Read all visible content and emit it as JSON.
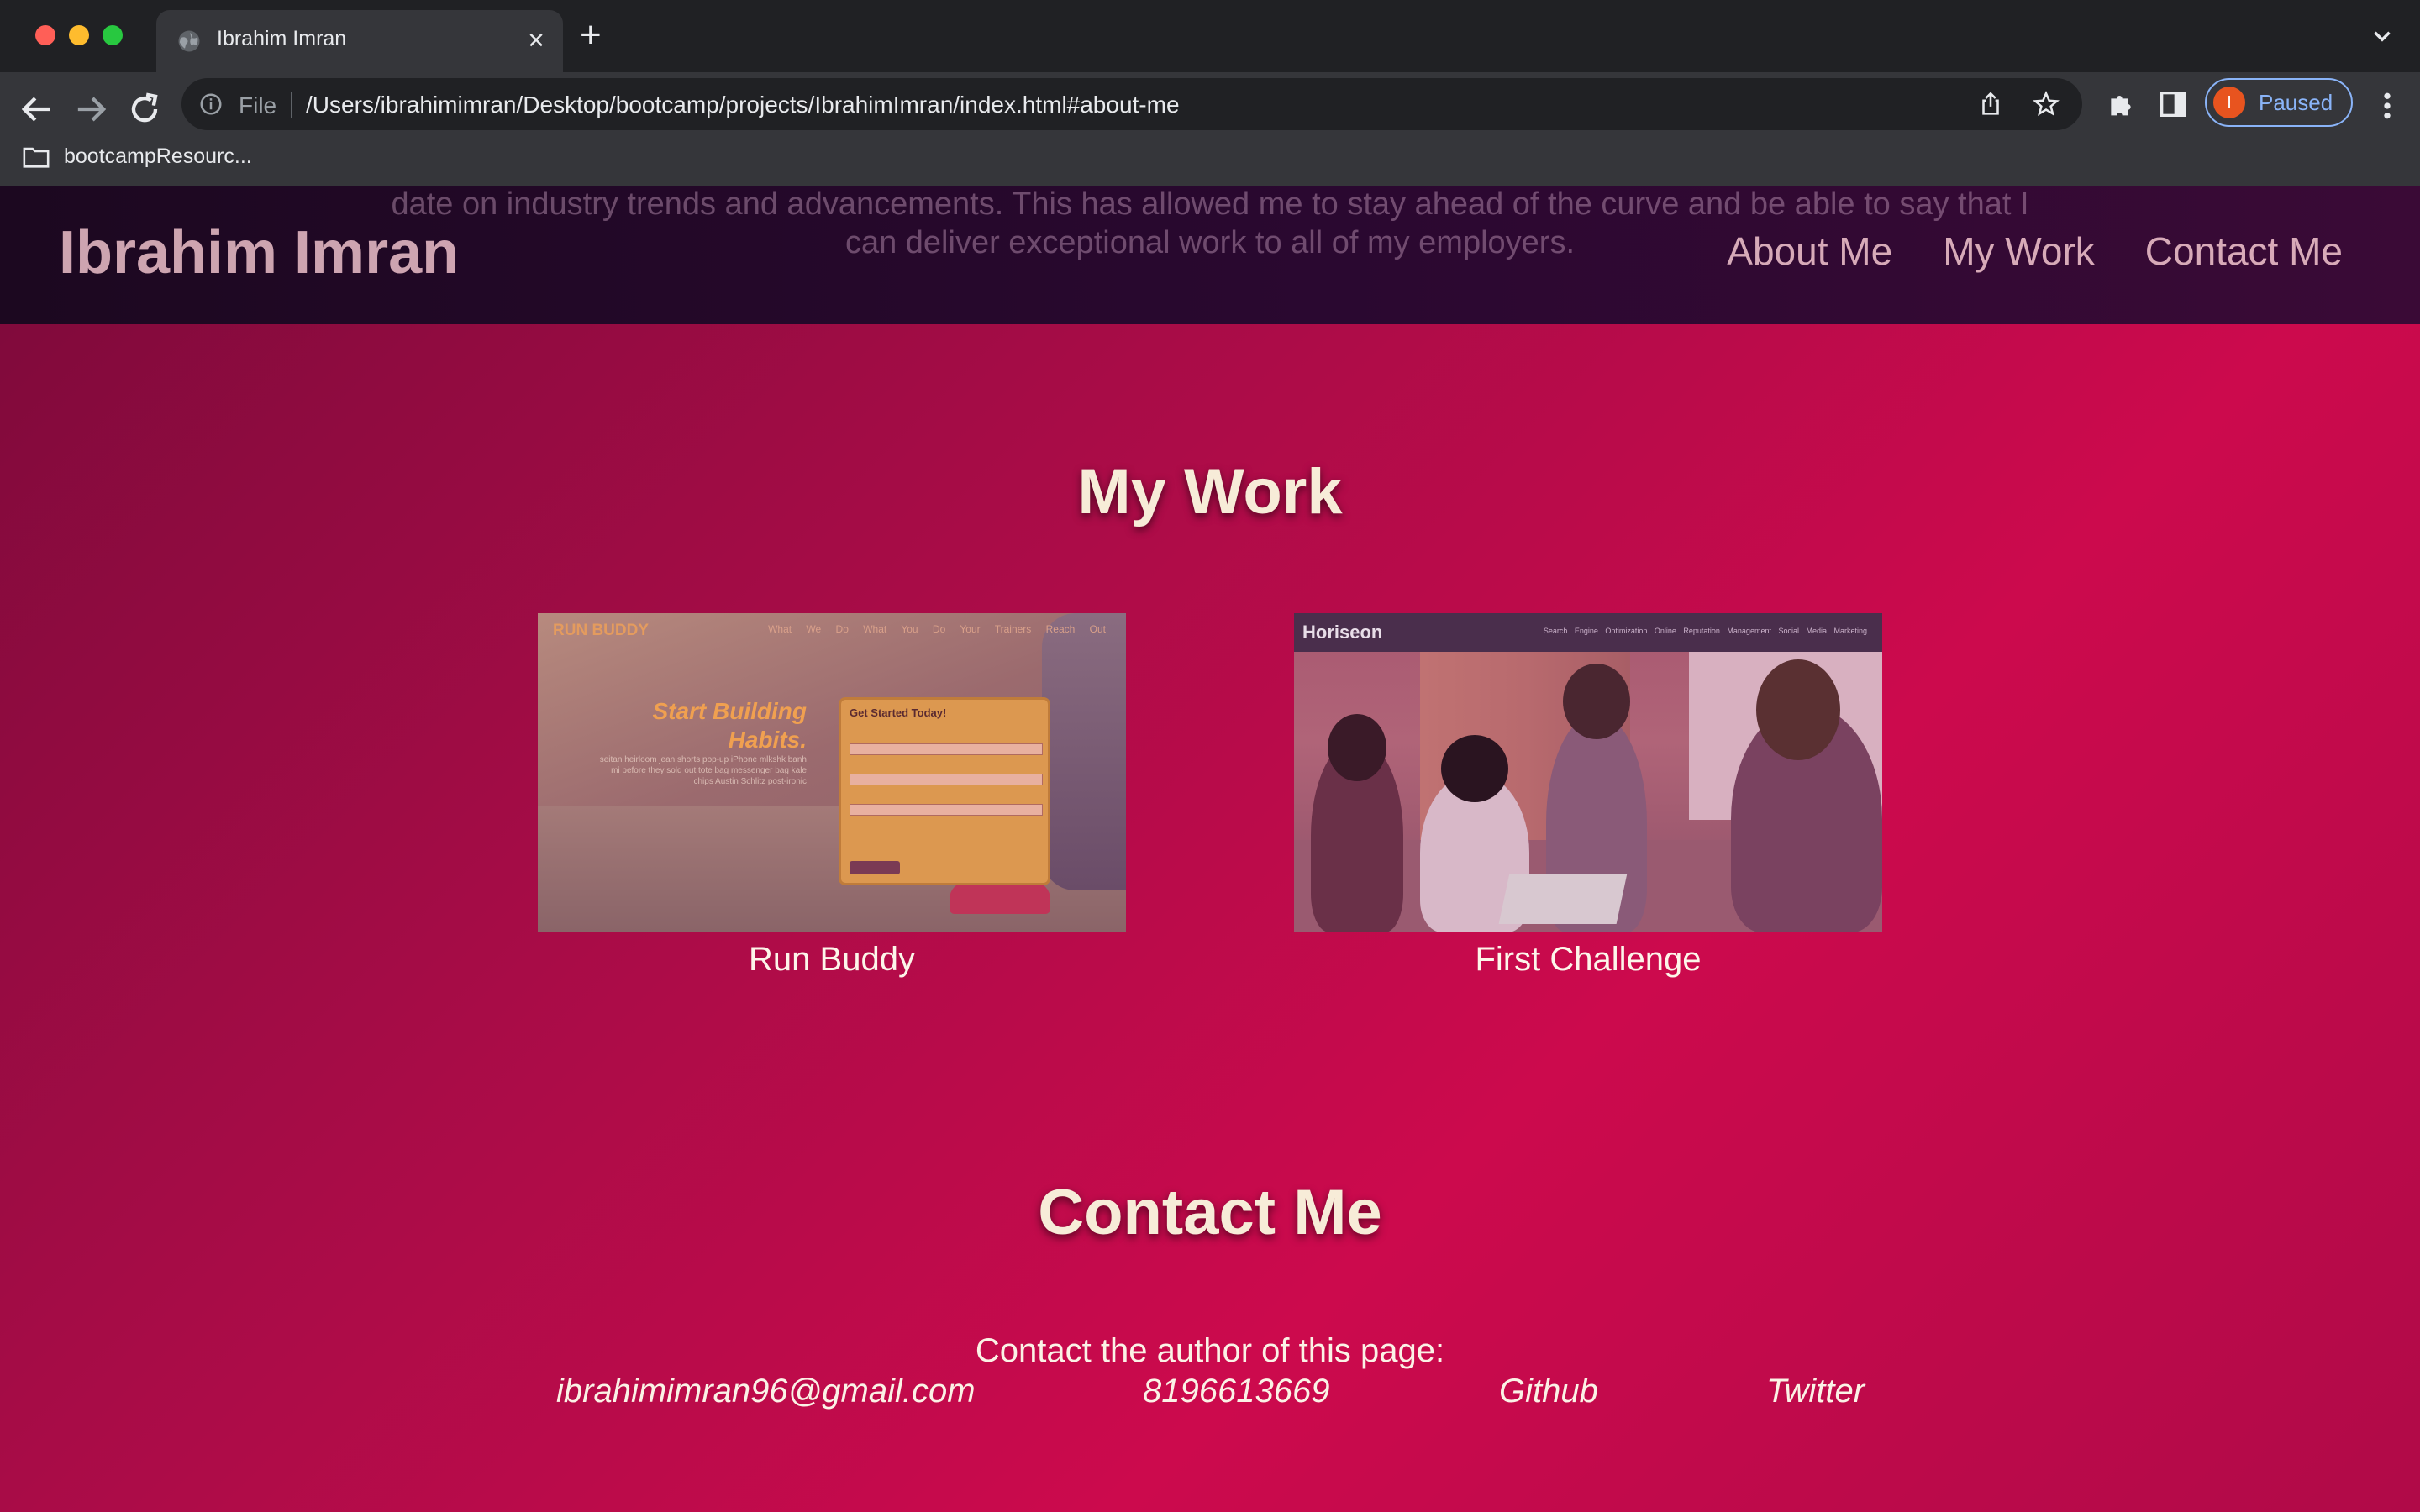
{
  "browser": {
    "tab_title": "Ibrahim Imran",
    "address_scheme": "File",
    "url": "/Users/ibrahimimran/Desktop/bootcamp/projects/IbrahimImran/index.html#about-me",
    "profile_initial": "I",
    "profile_status": "Paused",
    "bookmark_folder": "bootcampResourc...",
    "icons": [
      "globe-icon",
      "close-icon",
      "plus-icon",
      "chevron-down-icon",
      "back-icon",
      "forward-icon",
      "reload-icon",
      "info-icon",
      "share-icon",
      "star-icon",
      "puzzle-icon",
      "side-panel-icon",
      "more-vert-icon",
      "folder-icon"
    ],
    "colors": {
      "frame": "#202124",
      "toolbar": "#35363a",
      "accent": "#8ab4f8",
      "avatar": "#e8541f"
    }
  },
  "site": {
    "bleed_text_line1": "date on industry trends and advancements. This has allowed me to stay ahead of the curve and be able to say that I",
    "bleed_text_line2": "can deliver exceptional work to all of my employers.",
    "title": "Ibrahim Imran",
    "nav": [
      {
        "label": "About Me"
      },
      {
        "label": "My Work"
      },
      {
        "label": "Contact Me"
      }
    ],
    "colors": {
      "header": "#220826",
      "gradient_start": "#7c0a3a",
      "gradient_end": "#cc0a4d",
      "heading_text": "#f7ecd8"
    }
  },
  "work": {
    "title": "My Work",
    "projects": [
      {
        "caption": "Run Buddy",
        "thumb": {
          "brand": "RUN BUDDY",
          "links": "What We Do  What You Do  Your Trainers  Reach Out",
          "headline": "Start Building Habits.",
          "body": "seitan heirloom jean shorts pop-up iPhone mlkshk banh mi before they sold out tote bag messenger bag kale chips Austin Schlitz post-ironic",
          "form_title": "Get Started Today!"
        }
      },
      {
        "caption": "First Challenge",
        "thumb": {
          "brand": "Horiseon",
          "links": "Search Engine Optimization  Online Reputation Management  Social Media Marketing"
        }
      }
    ]
  },
  "contact": {
    "title": "Contact Me",
    "intro": "Contact the author of this page:",
    "email": "ibrahimimran96@gmail.com",
    "phone": "8196613669",
    "github": "Github",
    "twitter": "Twitter"
  }
}
